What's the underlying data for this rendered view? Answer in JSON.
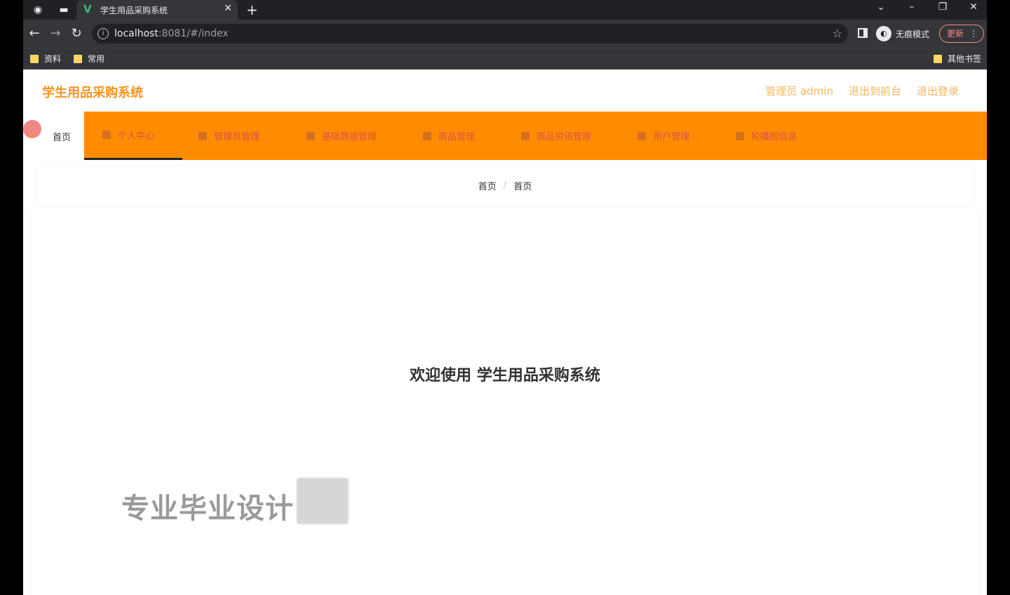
{
  "browser": {
    "tab_title": "学生用品采购系统",
    "tab_favicon": "vue-icon",
    "url_host": "localhost",
    "url_rest": ":8081/#/index",
    "incognito_label": "无痕模式",
    "update_label": "更新",
    "bookmarks": [
      {
        "label": "资料"
      },
      {
        "label": "常用"
      }
    ],
    "other_bookmarks": "其他书签"
  },
  "app": {
    "title": "学生用品采购系统",
    "header_links": [
      "管理员 admin",
      "退出到前台",
      "退出登录"
    ],
    "menu": [
      {
        "label": "首页",
        "icon": "home-icon",
        "active": false,
        "selected": true
      },
      {
        "label": "个人中心",
        "icon": "user-icon",
        "active": true
      },
      {
        "label": "管理员管理",
        "icon": "admin-icon"
      },
      {
        "label": "基础数据管理",
        "icon": "data-icon"
      },
      {
        "label": "商品管理",
        "icon": "goods-icon"
      },
      {
        "label": "商品资讯管理",
        "icon": "news-icon"
      },
      {
        "label": "用户管理",
        "icon": "users-icon"
      },
      {
        "label": "轮播图信息",
        "icon": "carousel-icon"
      }
    ],
    "breadcrumb": [
      "首页",
      "首页"
    ],
    "welcome": "欢迎使用 学生用品采购系统",
    "watermark": "专业毕业设计"
  },
  "colors": {
    "accent": "#ff8c00",
    "title": "#f7941d"
  }
}
